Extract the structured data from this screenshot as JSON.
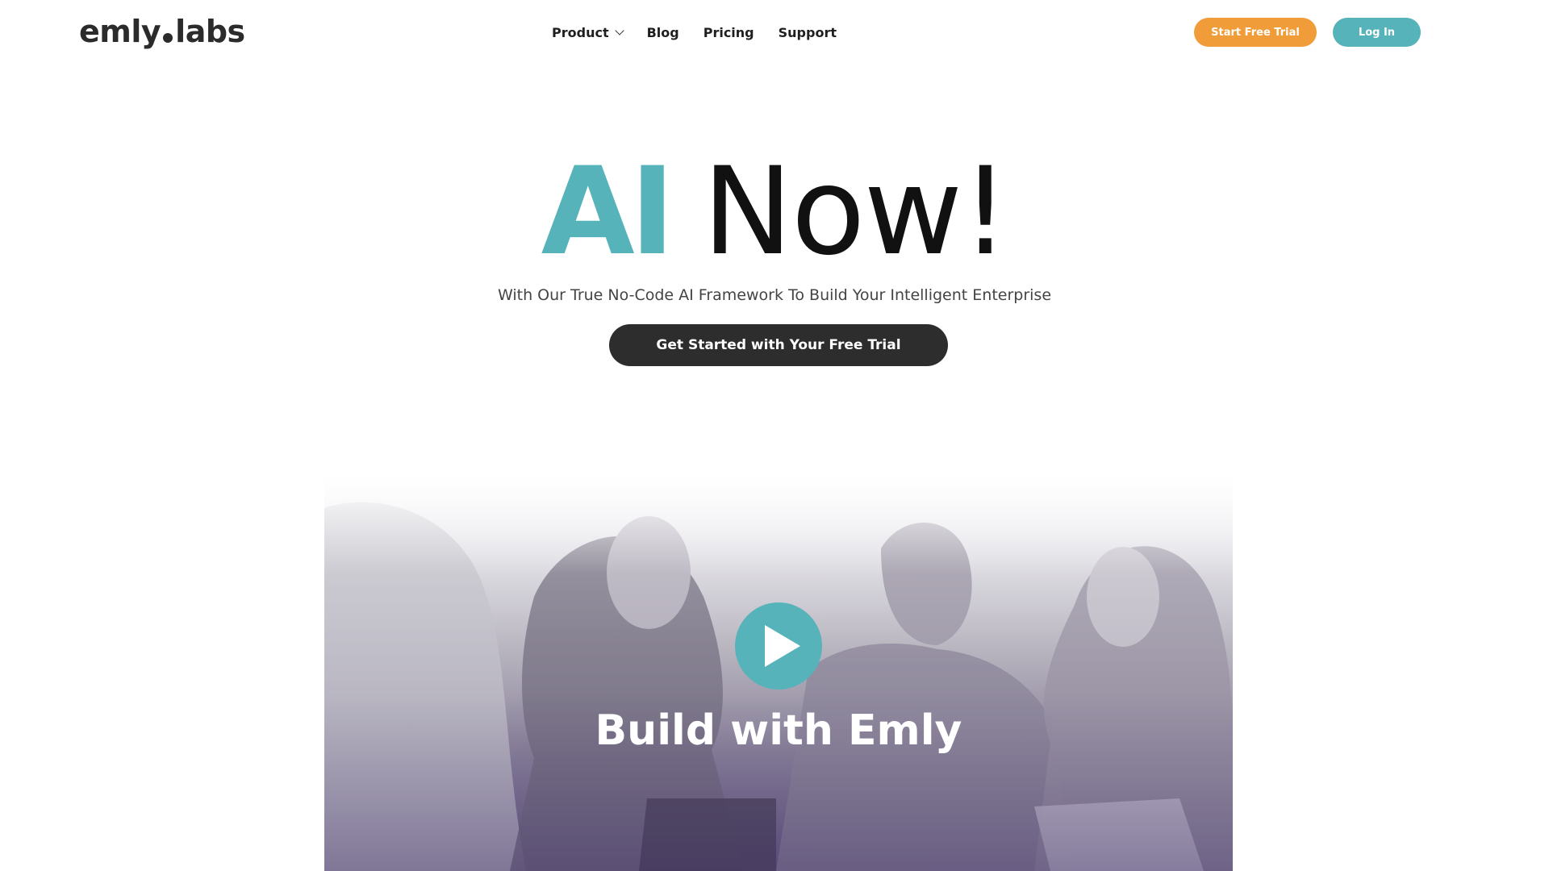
{
  "header": {
    "logo_left": "emly",
    "logo_right": "labs",
    "nav": [
      {
        "label": "Product"
      },
      {
        "label": "Blog"
      },
      {
        "label": "Pricing"
      },
      {
        "label": "Support"
      }
    ],
    "trial_label": "Start Free Trial",
    "login_label": "Log In"
  },
  "hero": {
    "title_accent": "AI",
    "title_rest": "Now!",
    "subtitle": "With Our True No-Code AI Framework To Build Your Intelligent Enterprise",
    "cta_label": "Get Started with Your Free Trial"
  },
  "video": {
    "caption": "Build with Emly"
  },
  "colors": {
    "teal": "#55b3b9",
    "orange": "#f09c38",
    "dark": "#2d2d2d",
    "purple_tint": "#665a80"
  },
  "icons": [
    "chevron-down-icon",
    "play-icon"
  ]
}
